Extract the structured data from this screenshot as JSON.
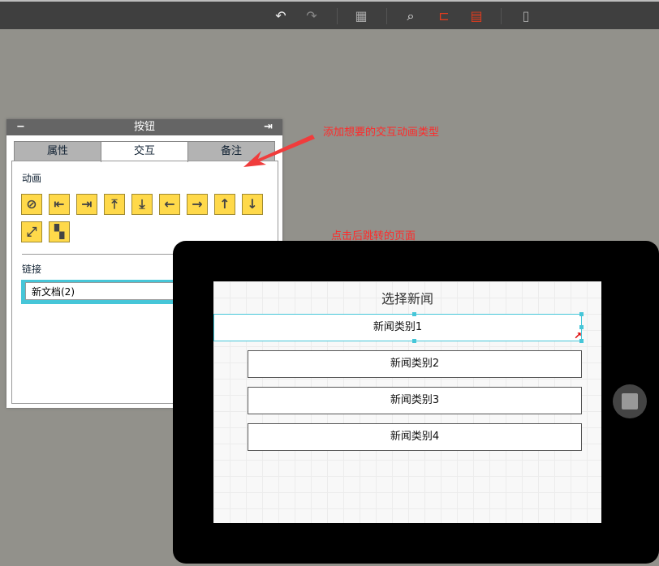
{
  "toolbar": {
    "icons": [
      "undo-icon",
      "redo-icon",
      "layout-icon",
      "search-icon",
      "align-icon",
      "clipboard-icon",
      "phone-icon"
    ],
    "accent": "#e03c1e"
  },
  "panel": {
    "title": "按钮",
    "collapse": "−",
    "pin": "⇥",
    "tabs": [
      {
        "label": "属性"
      },
      {
        "label": "交互",
        "active": true
      },
      {
        "label": "备注"
      }
    ],
    "animation_label": "动画",
    "animations": [
      {
        "icon": "none-icon",
        "glyph": "⊘"
      },
      {
        "icon": "slide-left-edge-icon",
        "glyph": "⇤"
      },
      {
        "icon": "slide-right-edge-icon",
        "glyph": "⇥"
      },
      {
        "icon": "slide-top-icon",
        "glyph": "⤒"
      },
      {
        "icon": "slide-bottom-icon",
        "glyph": "⤓"
      },
      {
        "icon": "arrow-left-icon",
        "glyph": "←"
      },
      {
        "icon": "arrow-right-icon",
        "glyph": "→"
      },
      {
        "icon": "arrow-up-icon",
        "glyph": "↑"
      },
      {
        "icon": "arrow-down-icon",
        "glyph": "↓"
      },
      {
        "icon": "expand-icon",
        "glyph": "⤢"
      },
      {
        "icon": "fade-icon",
        "glyph": "▚"
      }
    ],
    "link_label": "链接",
    "link_value": "新文档(2)"
  },
  "annotations": {
    "a1": "添加想要的交互动画类型",
    "a2": "点击后跳转的页面"
  },
  "screen": {
    "title": "选择新闻",
    "items": [
      "新闻类别1",
      "新闻类别2",
      "新闻类别3",
      "新闻类别4"
    ]
  }
}
